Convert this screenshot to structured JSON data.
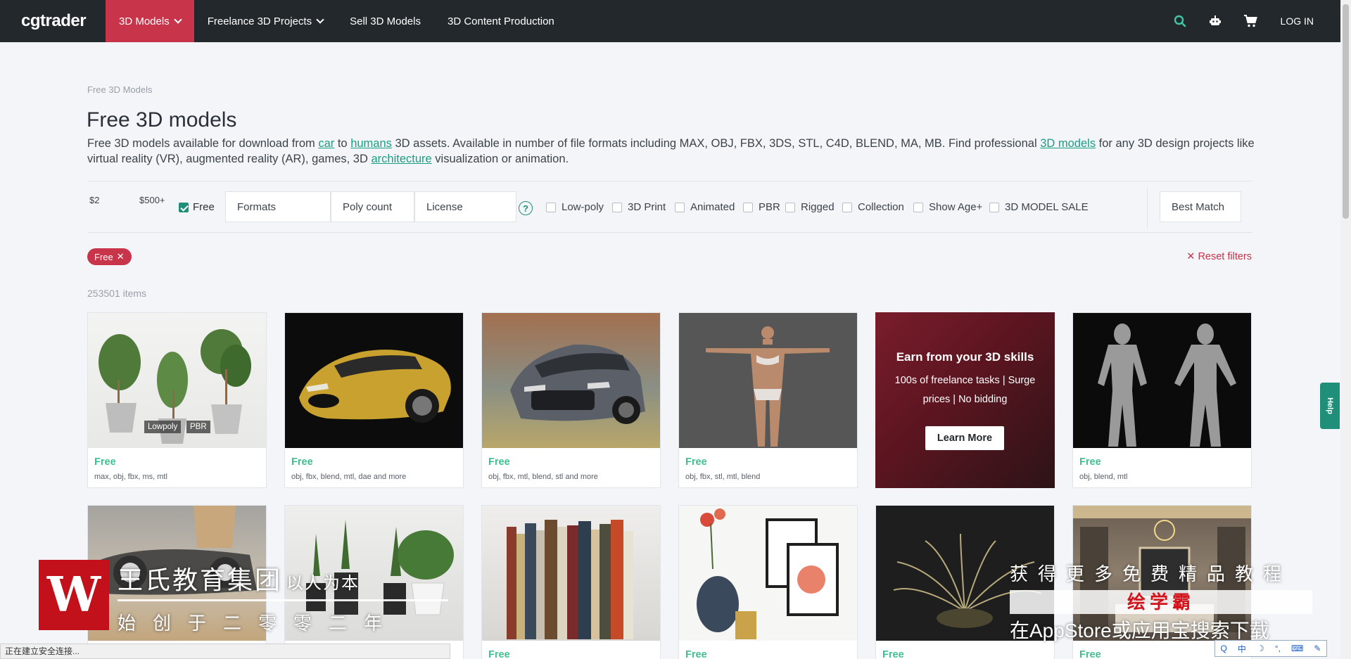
{
  "nav": {
    "logo": "cgtrader",
    "items": [
      {
        "label": "3D Models",
        "dropdown": true,
        "active": true
      },
      {
        "label": "Freelance 3D Projects",
        "dropdown": true,
        "active": false
      },
      {
        "label": "Sell 3D Models",
        "dropdown": false,
        "active": false
      },
      {
        "label": "3D Content Production",
        "dropdown": false,
        "active": false
      }
    ],
    "login": "LOG IN",
    "icons": [
      "search-icon",
      "robot-icon",
      "cart-icon"
    ],
    "accent": "#c8344a"
  },
  "breadcrumb": "Free 3D Models",
  "title": "Free 3D models",
  "description": {
    "p1": "Free 3D models available for download from ",
    "link1": "car",
    "p2": " to ",
    "link2": "humans",
    "p3": " 3D assets. Available in number of file formats including MAX, OBJ, FBX, 3DS, STL, C4D, BLEND, MA, MB. Find professional ",
    "link3": "3D models",
    "p4": " for any 3D design projects like virtual reality (VR), augmented reality (AR), games, 3D ",
    "link4": "architecture",
    "p5": " visualization or animation."
  },
  "filters": {
    "price_min": "$2",
    "price_max": "$500+",
    "free_label": "Free",
    "free_checked": true,
    "formats": "Formats",
    "poly_count": "Poly count",
    "license": "License",
    "help": "?",
    "options": [
      "Low-poly",
      "3D Print",
      "Animated",
      "PBR",
      "Rigged",
      "Collection",
      "Show Age+",
      "3D MODEL SALE"
    ],
    "sort": "Best Match"
  },
  "active_tag": "Free",
  "tag_close": "✕",
  "reset_icon": "✕",
  "reset": "Reset filters",
  "count": "253501 items",
  "cards": [
    {
      "price": "Free",
      "formats": "max, obj, fbx, ms, mtl",
      "badges": [
        "Lowpoly",
        "PBR"
      ]
    },
    {
      "price": "Free",
      "formats": "obj, fbx, blend, mtl, dae and more"
    },
    {
      "price": "Free",
      "formats": "obj, fbx, mtl, blend, stl and more"
    },
    {
      "price": "Free",
      "formats": "obj, fbx, stl, mtl, blend"
    },
    {
      "promo": true
    },
    {
      "price": "Free",
      "formats": "obj, blend, mtl"
    },
    {
      "price": "",
      "formats": ""
    },
    {
      "price": "",
      "formats": ""
    },
    {
      "price": "Free",
      "formats": ""
    },
    {
      "price": "Free",
      "formats": ""
    },
    {
      "price": "Free",
      "formats": ""
    },
    {
      "price": "Free",
      "formats": ""
    }
  ],
  "promo": {
    "title": "Earn from your 3D skills",
    "subtitle": "100s of freelance tasks | Surge prices | No bidding",
    "button": "Learn More"
  },
  "help_tab": "Help",
  "watermark": {
    "logo": "W",
    "line1": "王氏教育集团",
    "line1_small": "以人为本",
    "line2": "始创于二零零二年",
    "right1": "获得更多免费精品教程",
    "right2": "绘学霸",
    "right3": "在AppStore或应用宝搜索下载"
  },
  "status": "正在建立安全连接...",
  "ime": {
    "logo": "Q",
    "lang": "中"
  }
}
